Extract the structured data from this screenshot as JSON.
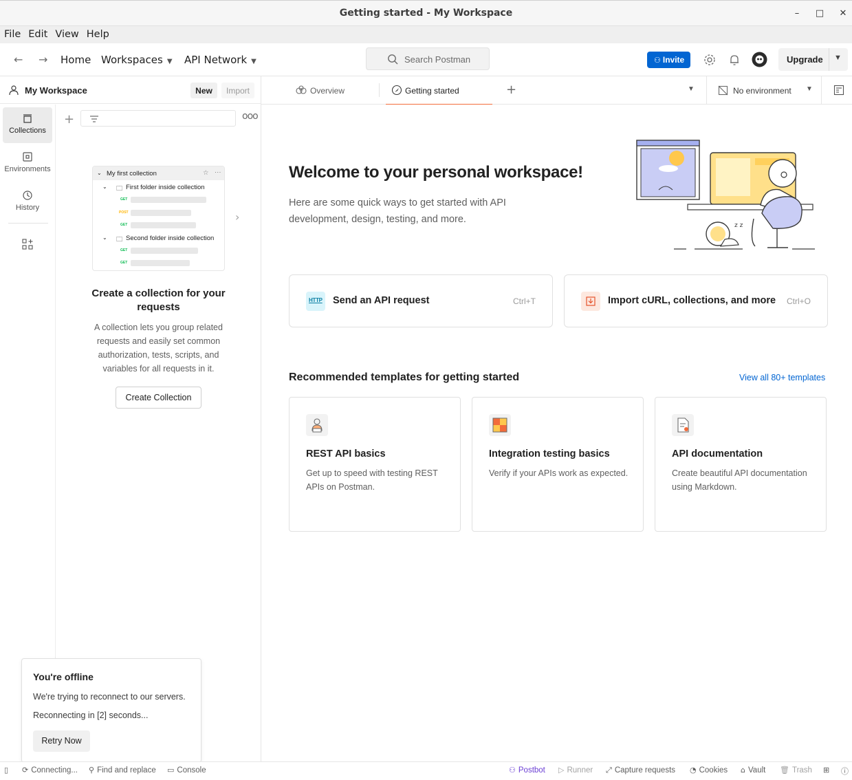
{
  "window": {
    "title": "Getting started - My Workspace",
    "controls": {
      "minimize": "–",
      "maximize": "□",
      "close": "✕"
    }
  },
  "menu": [
    "File",
    "Edit",
    "View",
    "Help"
  ],
  "header": {
    "home": "Home",
    "workspaces": "Workspaces",
    "api_network": "API Network",
    "search_placeholder": "Search Postman",
    "invite": "Invite",
    "upgrade": "Upgrade"
  },
  "sidebar": {
    "workspace_name": "My Workspace",
    "new_label": "New",
    "import_label": "Import",
    "rail": [
      {
        "label": "Collections",
        "icon": "collections-icon"
      },
      {
        "label": "Environments",
        "icon": "environments-icon"
      },
      {
        "label": "History",
        "icon": "history-icon"
      }
    ],
    "preview": {
      "collection": "My first collection",
      "folder1": "First folder inside collection",
      "folder2": "Second folder inside collection",
      "methods": [
        "GET",
        "POST",
        "GET",
        "GET",
        "GET"
      ]
    },
    "empty_title": "Create a collection for your requests",
    "empty_desc": "A collection lets you group related requests and easily set common authorization, tests, scripts, and variables for all requests in it.",
    "create_button": "Create Collection"
  },
  "toast": {
    "title": "You're offline",
    "line1": "We're trying to reconnect to our servers.",
    "line2": "Reconnecting in [2] seconds...",
    "button": "Retry Now"
  },
  "tabs": {
    "items": [
      {
        "label": "Overview",
        "icon": "overview-icon"
      },
      {
        "label": "Getting started",
        "icon": "getting-started-icon"
      }
    ],
    "environment": "No environment"
  },
  "main": {
    "welcome_title": "Welcome to your personal workspace!",
    "welcome_sub": "Here are some quick ways to get started with API development, design, testing, and more.",
    "actions": [
      {
        "label": "Send an API request",
        "shortcut": "Ctrl+T",
        "icon": "http-icon"
      },
      {
        "label": "Import cURL, collections, and more",
        "shortcut": "Ctrl+O",
        "icon": "import-icon"
      }
    ],
    "recommended_title": "Recommended templates for getting started",
    "view_all": "View all 80+ templates",
    "templates": [
      {
        "title": "REST API basics",
        "desc": "Get up to speed with testing REST APIs on Postman.",
        "icon": "rest-api-icon"
      },
      {
        "title": "Integration testing basics",
        "desc": "Verify if your APIs work as expected.",
        "icon": "integration-icon"
      },
      {
        "title": "API documentation",
        "desc": "Create beautiful API documentation using Markdown.",
        "icon": "documentation-icon"
      }
    ]
  },
  "statusbar": {
    "connecting": "Connecting...",
    "find_replace": "Find and replace",
    "console": "Console",
    "postbot": "Postbot",
    "runner": "Runner",
    "capture": "Capture requests",
    "cookies": "Cookies",
    "vault": "Vault",
    "trash": "Trash"
  },
  "colors": {
    "accent": "#0265d2",
    "tab_active": "#f26b3a",
    "postbot": "#6b3fd4"
  }
}
